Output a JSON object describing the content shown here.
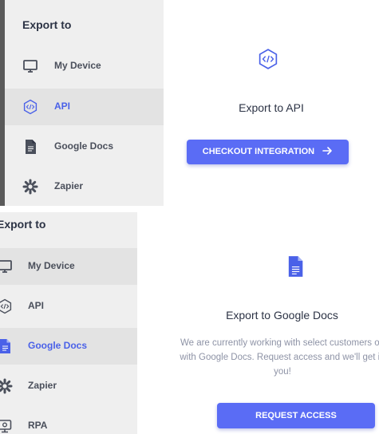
{
  "colors": {
    "accent": "#4a61e8",
    "button": "#5a6cf5",
    "sidebar_bg": "#efefef",
    "sidebar_active_bg": "#e3e3e3"
  },
  "panel_api": {
    "sidebar": {
      "title": "Export to",
      "items": [
        {
          "label": "My Device",
          "icon": "monitor-icon"
        },
        {
          "label": "API",
          "icon": "api-code-icon",
          "active": true
        },
        {
          "label": "Google Docs",
          "icon": "google-docs-icon"
        },
        {
          "label": "Zapier",
          "icon": "zapier-icon"
        }
      ]
    },
    "content": {
      "icon": "api-code-icon",
      "title": "Export to API",
      "button_label": "CHECKOUT INTEGRATION",
      "button_icon": "arrow-right-icon"
    }
  },
  "panel_gdocs": {
    "sidebar": {
      "title": "Export to",
      "items": [
        {
          "label": "My Device",
          "icon": "monitor-icon"
        },
        {
          "label": "API",
          "icon": "api-code-icon"
        },
        {
          "label": "Google Docs",
          "icon": "google-docs-icon",
          "active": true
        },
        {
          "label": "Zapier",
          "icon": "zapier-icon"
        },
        {
          "label": "RPA",
          "icon": "rpa-robot-icon"
        }
      ]
    },
    "content": {
      "icon": "google-docs-icon",
      "title": "Export to Google Docs",
      "description_lines": [
        "We are currently working with select customers on",
        "with Google Docs. Request access and we'll get in",
        "you!"
      ],
      "button_label": "REQUEST ACCESS"
    }
  }
}
